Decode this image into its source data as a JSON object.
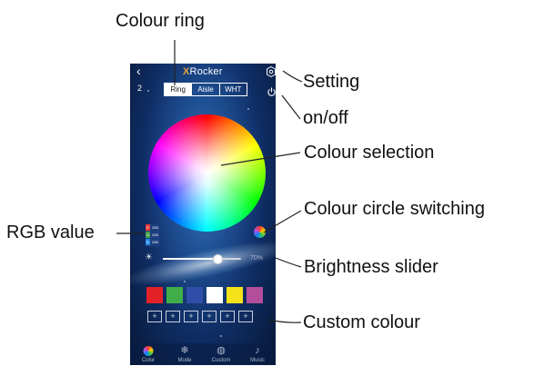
{
  "callouts": {
    "colour_ring": "Colour ring",
    "setting": "Setting",
    "on_off": "on/off",
    "colour_selection": "Colour selection",
    "colour_circle_switching": "Colour circle switching",
    "rgb_value": "RGB value",
    "brightness_slider": "Brightness slider",
    "custom_colour": "Custom colour"
  },
  "app": {
    "back_glyph": "‹",
    "logo_x": "X",
    "logo_rest": "Rocker",
    "device_number": "2",
    "tabs": [
      {
        "label": "Ring",
        "active": true
      },
      {
        "label": "Aisle",
        "active": false
      },
      {
        "label": "WHT",
        "active": false
      }
    ],
    "rgb": [
      {
        "key": "R",
        "value": "255",
        "color": "#e53935"
      },
      {
        "key": "G",
        "value": "255",
        "color": "#43a047"
      },
      {
        "key": "B",
        "value": "255",
        "color": "#1e88e5"
      }
    ],
    "brightness": {
      "percent": 70,
      "label": "70%"
    },
    "swatches": [
      "#e32227",
      "#3fae49",
      "#2f4ea8",
      "#ffffff",
      "#f5e21b",
      "#b44e9a"
    ],
    "custom_slots": [
      "+",
      "+",
      "+",
      "+",
      "+",
      "+"
    ],
    "bottom_tabs": [
      {
        "label": "Color",
        "icon": "color-ring-icon"
      },
      {
        "label": "Mode",
        "icon": "snowflake-icon"
      },
      {
        "label": "Custom",
        "icon": "palette-icon"
      },
      {
        "label": "Music",
        "icon": "music-note-icon"
      }
    ]
  }
}
